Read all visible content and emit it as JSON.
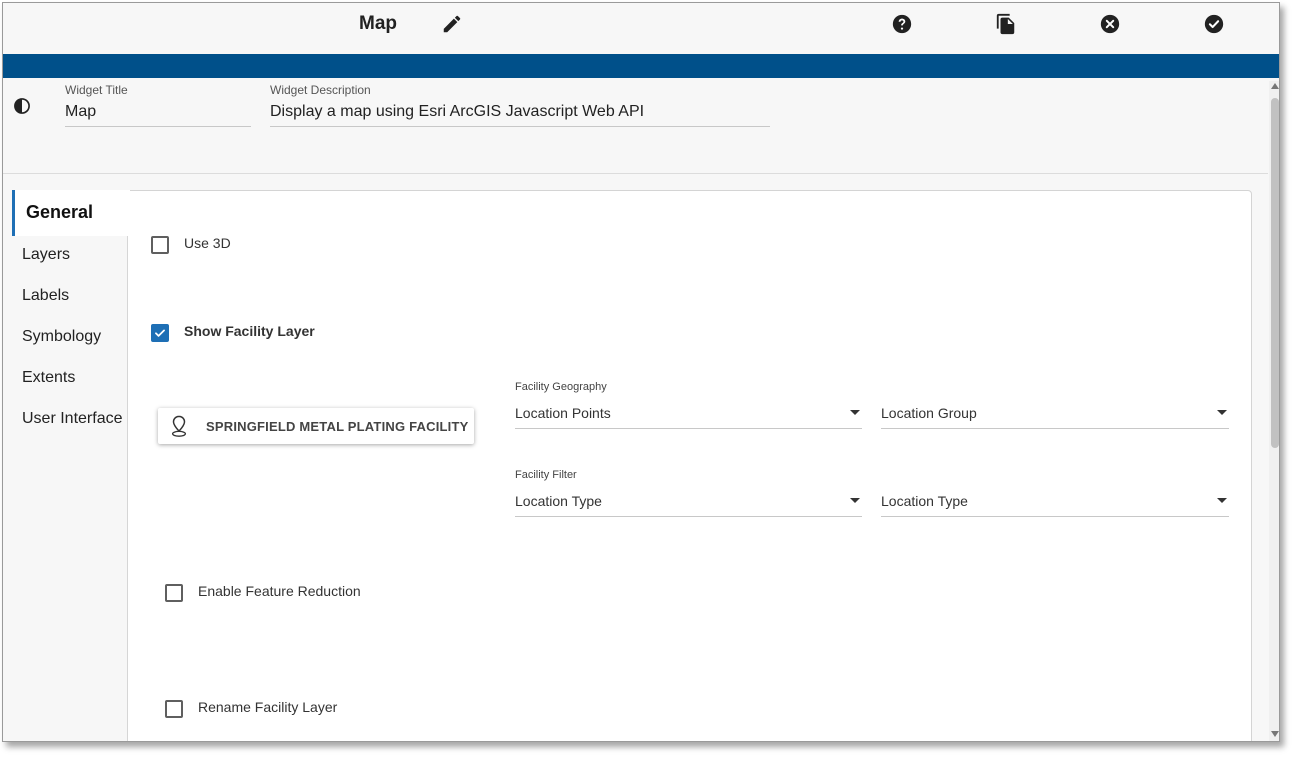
{
  "header": {
    "title": "Map",
    "icons": [
      "pencil-icon",
      "help-icon",
      "copy-icon",
      "close-circle-icon",
      "check-circle-icon"
    ]
  },
  "colors": {
    "brand_bar": "#00508a",
    "accent": "#1e6fb5"
  },
  "widget": {
    "title_label": "Widget Title",
    "title_value": "Map",
    "description_label": "Widget Description",
    "description_value": "Display a map using Esri ArcGIS Javascript Web API",
    "theme_icon": "contrast-icon"
  },
  "sidenav": {
    "active": "General",
    "items": [
      "Layers",
      "Labels",
      "Symbology",
      "Extents",
      "User Interface"
    ]
  },
  "general": {
    "use_3d": {
      "label": "Use 3D",
      "checked": false
    },
    "show_facility_layer": {
      "label": "Show Facility Layer",
      "checked": true
    },
    "facility_chip": {
      "label": "SPRINGFIELD METAL PLATING FACILITY",
      "icon": "location-pin-icon"
    },
    "facility_geography": {
      "label": "Facility Geography",
      "value": "Location Points",
      "secondary_value": "Location Group"
    },
    "facility_filter": {
      "label": "Facility Filter",
      "value": "Location Type",
      "secondary_value": "Location Type"
    },
    "enable_feature_reduction": {
      "label": "Enable Feature Reduction",
      "checked": false
    },
    "rename_facility_layer": {
      "label": "Rename Facility Layer",
      "checked": false
    }
  }
}
